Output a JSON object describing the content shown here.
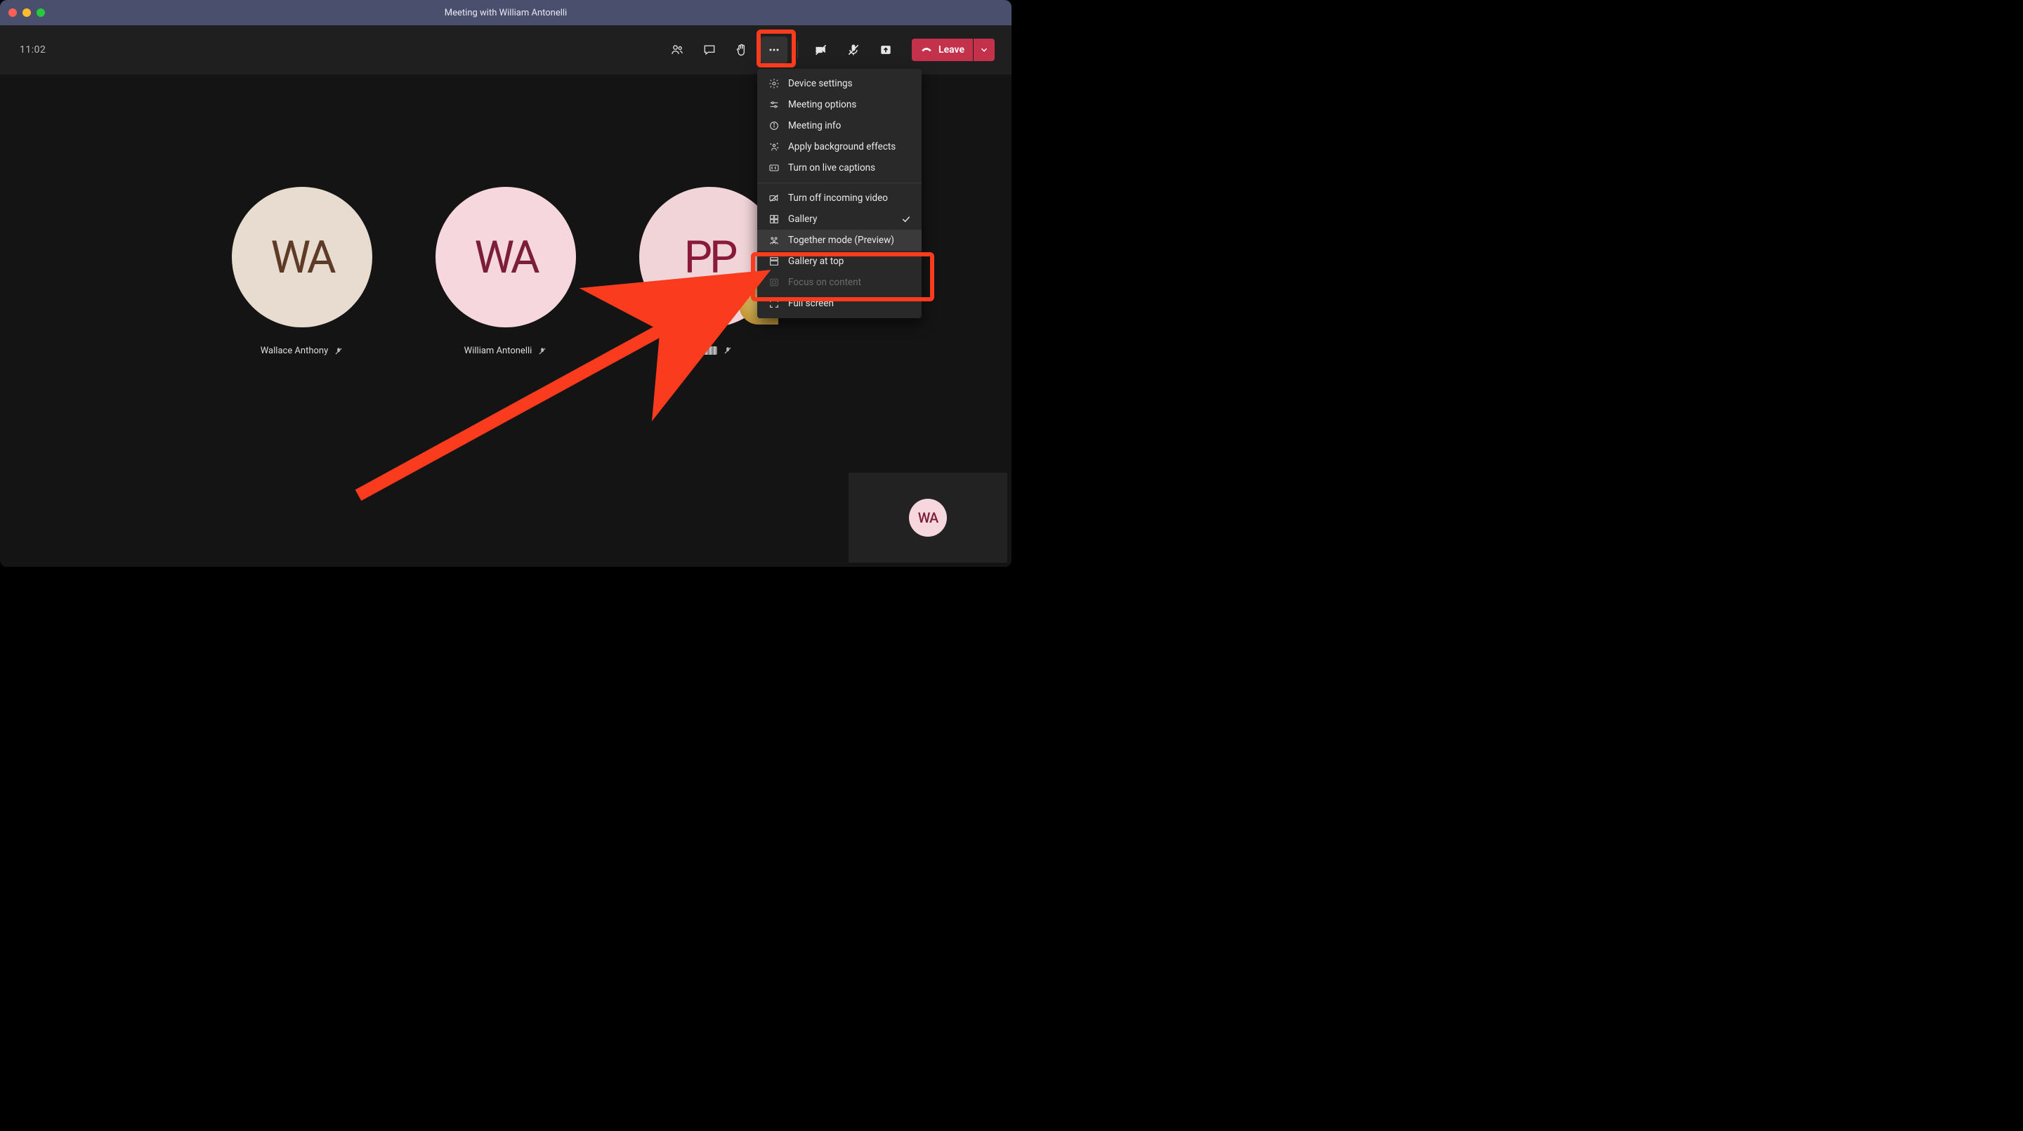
{
  "window": {
    "title": "Meeting with William Antonelli"
  },
  "toolbar": {
    "timer": "11:02",
    "leave_label": "Leave"
  },
  "participants": [
    {
      "initials": "WA",
      "name": "Wallace Anthony",
      "muted": true
    },
    {
      "initials": "WA",
      "name": "William Antonelli",
      "muted": true
    },
    {
      "initials": "PP",
      "name": "",
      "muted": true,
      "redacted": true
    }
  ],
  "self_view": {
    "initials": "WA"
  },
  "menu": {
    "items": [
      {
        "icon": "gear-icon",
        "label": "Device settings"
      },
      {
        "icon": "sliders-icon",
        "label": "Meeting options"
      },
      {
        "icon": "info-icon",
        "label": "Meeting info"
      },
      {
        "icon": "sparkle-icon",
        "label": "Apply background effects"
      },
      {
        "icon": "cc-icon",
        "label": "Turn on live captions"
      }
    ],
    "items2": [
      {
        "icon": "video-off-icon",
        "label": "Turn off incoming video"
      },
      {
        "icon": "grid-icon",
        "label": "Gallery",
        "checked": true
      },
      {
        "icon": "people-icon",
        "label": "Together mode (Preview)",
        "highlight": true
      },
      {
        "icon": "gallery-top-icon",
        "label": "Gallery at top"
      },
      {
        "icon": "focus-icon",
        "label": "Focus on content",
        "disabled": true
      },
      {
        "icon": "fullscreen-icon",
        "label": "Full screen"
      }
    ]
  },
  "annotation": {
    "highlight_more_actions": true,
    "highlight_together_mode": true
  }
}
